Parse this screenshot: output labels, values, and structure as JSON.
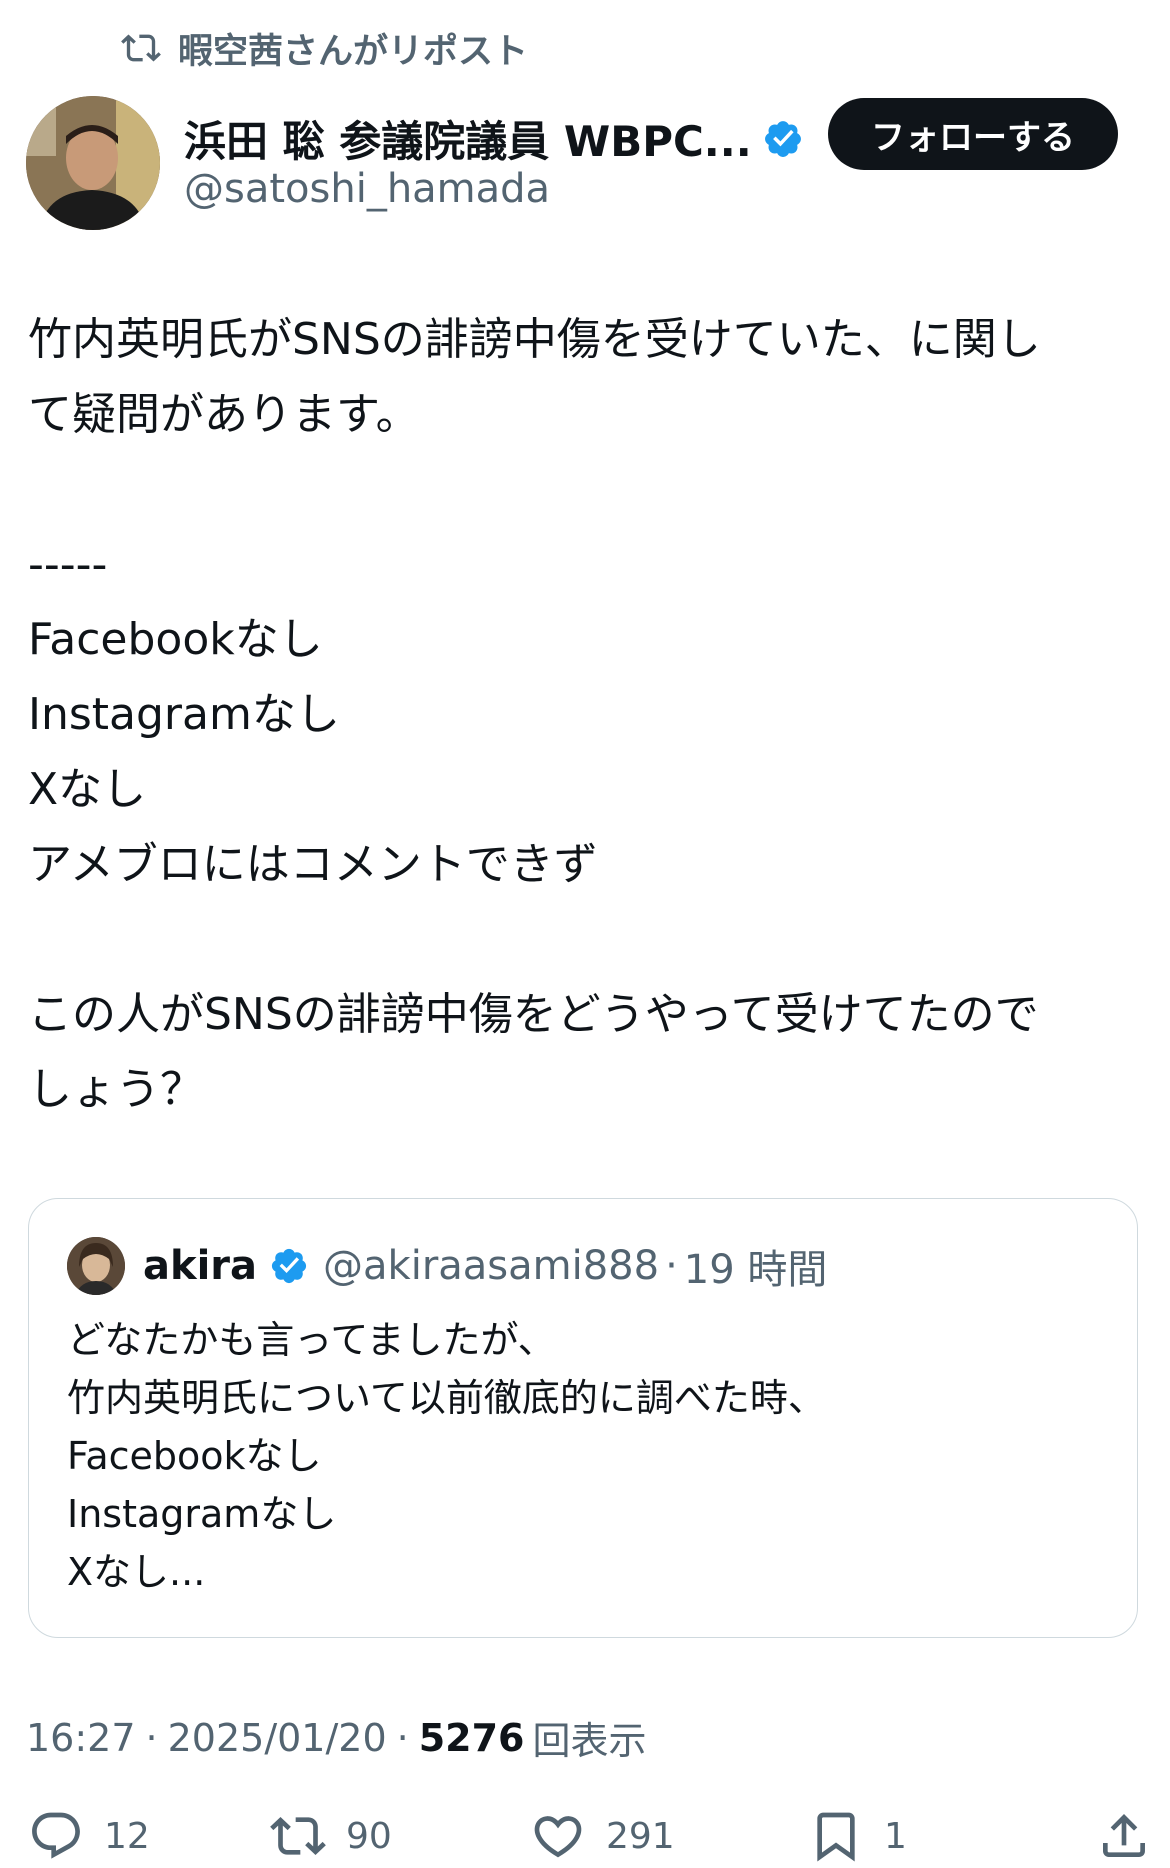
{
  "repost": {
    "icon": "repost-icon",
    "label": "暇空茜さんがリポスト"
  },
  "author": {
    "display_name": "浜田 聡 参議院議員 WBPC...",
    "handle": "@satoshi_hamada",
    "verified_icon": "verified-badge-icon"
  },
  "follow_button": {
    "label": "フォローする"
  },
  "tweet": {
    "lines": [
      "竹内英明氏がSNSの誹謗中傷を受けていた、に関し",
      "て疑問があります。",
      "",
      "-----",
      "Facebookなし",
      "Instagramなし",
      "Xなし",
      "アメブロにはコメントできず",
      "",
      "この人がSNSの誹謗中傷をどうやって受けてたので",
      "しょう？"
    ]
  },
  "quote": {
    "name": "akira",
    "handle": "@akiraasami888",
    "separator": "·",
    "time": "19 時間",
    "lines": [
      "どなたかも言ってましたが、",
      "竹内英明氏について以前徹底的に調べた時、",
      "Facebookなし",
      "Instagramなし",
      "Xなし..."
    ]
  },
  "meta": {
    "time": "16:27",
    "separator": "·",
    "date": "2025/01/20",
    "views_count": "5276",
    "views_label": "回表示"
  },
  "actions": {
    "reply": {
      "icon": "reply-icon",
      "count": "12"
    },
    "retweet": {
      "icon": "repost-icon",
      "count": "90"
    },
    "like": {
      "icon": "heart-icon",
      "count": "291"
    },
    "bookmark": {
      "icon": "bookmark-icon",
      "count": "1"
    },
    "share": {
      "icon": "share-icon"
    }
  },
  "colors": {
    "text": "#0f1419",
    "secondary": "#536471",
    "verified": "#1d9bf0",
    "border": "#cfd9de"
  }
}
